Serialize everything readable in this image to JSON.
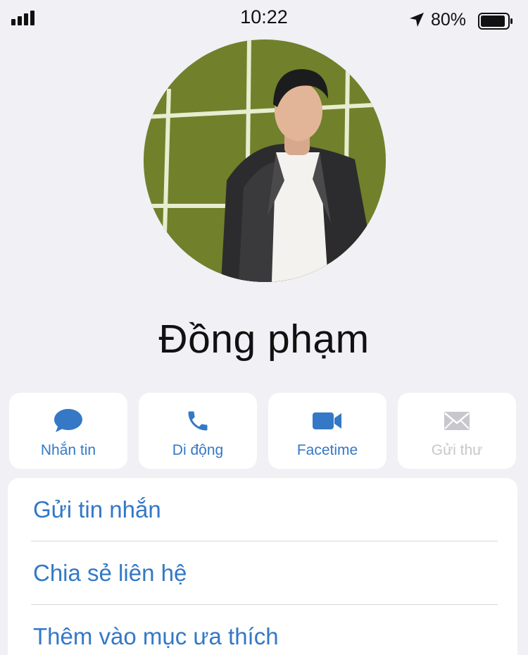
{
  "status_bar": {
    "time": "10:22",
    "battery_percent": "80%",
    "signal_bars": 4,
    "icons": [
      "signal-icon",
      "location-arrow-icon",
      "battery-icon"
    ]
  },
  "contact": {
    "name": "Đồng phạm",
    "avatar": "profile-photo"
  },
  "actions": [
    {
      "label": "Nhắn tin",
      "icon": "message-bubble-icon",
      "enabled": true
    },
    {
      "label": "Di động",
      "icon": "phone-icon",
      "enabled": true
    },
    {
      "label": "Facetime",
      "icon": "video-camera-icon",
      "enabled": true
    },
    {
      "label": "Gửi thư",
      "icon": "mail-icon",
      "enabled": false
    }
  ],
  "list": [
    {
      "label": "Gửi tin nhắn"
    },
    {
      "label": "Chia sẻ liên hệ"
    },
    {
      "label": "Thêm vào mục ưa thích"
    }
  ],
  "colors": {
    "accent": "#3478c6",
    "background": "#f0f0f5",
    "card": "#ffffff",
    "disabled": "#c7c7cc",
    "avatar_backdrop": "#7b8a30"
  }
}
